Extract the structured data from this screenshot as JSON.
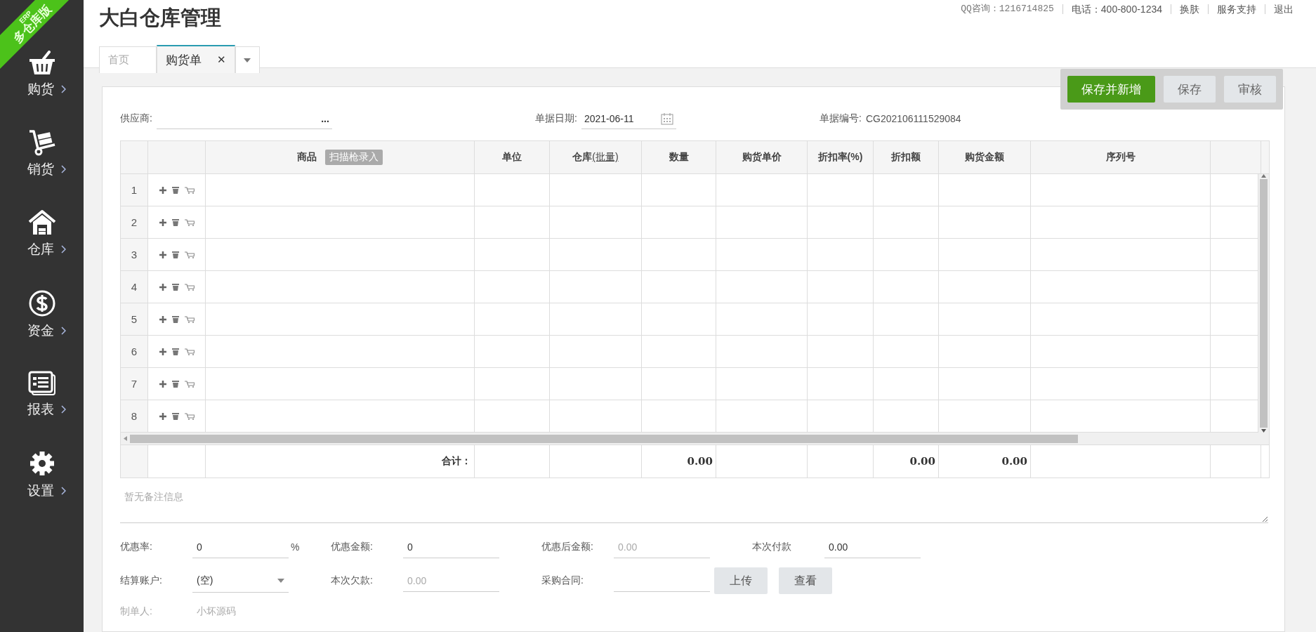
{
  "ribbon": {
    "top": "ERP",
    "bottom": "多仓库版"
  },
  "sidebar": {
    "items": [
      {
        "label": "购货"
      },
      {
        "label": "销货"
      },
      {
        "label": "仓库"
      },
      {
        "label": "资金"
      },
      {
        "label": "报表"
      },
      {
        "label": "设置"
      }
    ]
  },
  "app_title": "大白仓库管理",
  "header_links": [
    "QQ咨询：1216714825",
    "电话：400-800-1234",
    "换肤",
    "服务支持",
    "退出"
  ],
  "tabs": [
    {
      "label": "首页",
      "selected": false,
      "closable": false
    },
    {
      "label": "购货单",
      "selected": true,
      "closable": true
    }
  ],
  "tab_close": "✕",
  "toolbar": {
    "buttons": [
      {
        "label": "保存并新增",
        "kind": "primary"
      },
      {
        "label": "保存",
        "kind": "plain"
      },
      {
        "label": "审核",
        "kind": "plain"
      }
    ]
  },
  "form": {
    "supplier": {
      "label": "供应商:",
      "more": "..."
    },
    "date": {
      "label": "单据日期:",
      "value": "2021-06-11"
    },
    "number": {
      "label": "单据编号:",
      "value": "CG202106111529084"
    }
  },
  "table": {
    "columns": [
      {},
      {},
      {
        "label": "商品",
        "badge": "扫描枪录入"
      },
      {
        "label": "单位"
      },
      {
        "label": "仓库",
        "link": "(批量)"
      },
      {
        "label": "数量"
      },
      {
        "label": "购货单价"
      },
      {
        "label": "折扣率(%)"
      },
      {
        "label": "折扣额"
      },
      {
        "label": "购货金额"
      },
      {
        "label": "序列号"
      },
      {}
    ],
    "rows": [
      {
        "number": "1"
      },
      {
        "number": "2"
      },
      {
        "number": "3"
      },
      {
        "number": "4"
      },
      {
        "number": "5"
      },
      {
        "number": "6"
      },
      {
        "number": "7"
      },
      {
        "number": "8"
      }
    ],
    "total": {
      "label": "合计：",
      "cells": {
        "5": "0.00",
        "8": "0.00",
        "9": "0.00"
      }
    }
  },
  "notes": {
    "placeholder": "暂无备注信息"
  },
  "summary": [
    [
      {
        "label": "优惠率:",
        "kind": "input",
        "value": "0",
        "suffix": "%",
        "disabled": false
      },
      {
        "label": "优惠金额:",
        "kind": "input",
        "value": "0",
        "disabled": false
      },
      {
        "label": "优惠后金额:",
        "kind": "input",
        "value": "0.00",
        "disabled": true
      },
      {
        "label": "本次付款",
        "kind": "input",
        "value": "0.00",
        "disabled": false
      }
    ],
    [
      {
        "label": "结算账户:",
        "kind": "select",
        "value": "(空)",
        "disabled": false
      },
      {
        "label": "本次欠款:",
        "kind": "input",
        "value": "0.00",
        "disabled": true
      },
      {
        "label": "采购合同:",
        "kind": "upload",
        "buttons": [
          "上传",
          "查看"
        ]
      }
    ],
    [
      {
        "label": "制单人:",
        "kind": "text",
        "value": "小坏源码",
        "disabled": true
      }
    ]
  ]
}
